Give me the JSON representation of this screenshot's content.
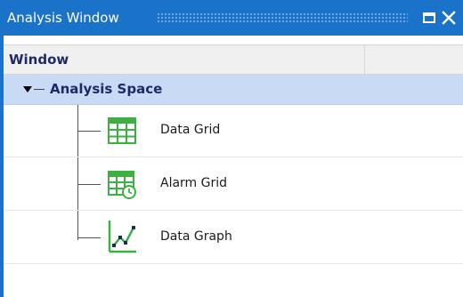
{
  "window": {
    "title": "Analysis Window",
    "maximize_icon": "maximize-icon",
    "close_icon": "close-icon"
  },
  "tree": {
    "column_header": "Window",
    "root": {
      "label": "Analysis Space",
      "expanded": true
    },
    "items": [
      {
        "label": "Data Grid",
        "icon": "data-grid-icon"
      },
      {
        "label": "Alarm Grid",
        "icon": "alarm-grid-icon"
      },
      {
        "label": "Data Graph",
        "icon": "data-graph-icon"
      }
    ]
  },
  "colors": {
    "titlebar": "#1a73c8",
    "selected_row": "#c9daf5",
    "header_text": "#1e2a63",
    "icon_green": "#3cb043"
  }
}
